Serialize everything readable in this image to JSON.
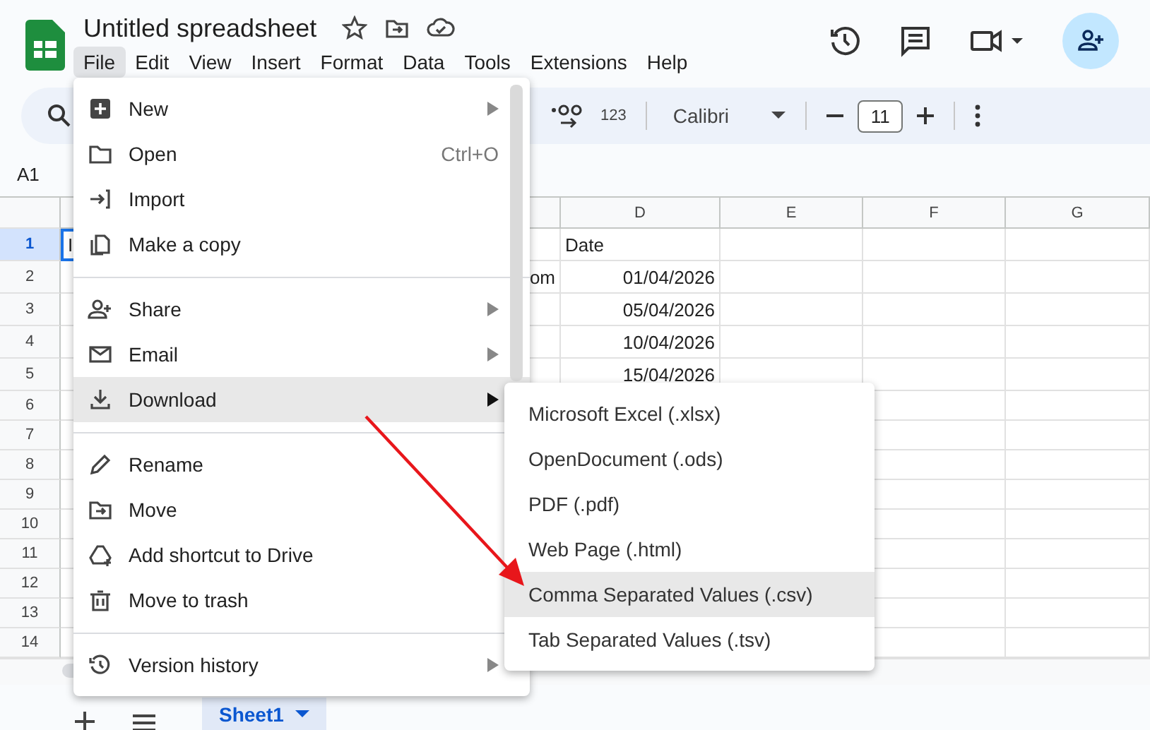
{
  "app": {
    "title": "Untitled spreadsheet"
  },
  "menubar": [
    {
      "label": "File",
      "selected": true
    },
    {
      "label": "Edit",
      "selected": false
    },
    {
      "label": "View",
      "selected": false
    },
    {
      "label": "Insert",
      "selected": false
    },
    {
      "label": "Format",
      "selected": false
    },
    {
      "label": "Data",
      "selected": false
    },
    {
      "label": "Tools",
      "selected": false
    },
    {
      "label": "Extensions",
      "selected": false
    },
    {
      "label": "Help",
      "selected": false
    }
  ],
  "toolbar": {
    "number_format": "123",
    "font": "Calibri",
    "font_size": "11"
  },
  "name_box": "A1",
  "columns": [
    "D",
    "E",
    "F",
    "G"
  ],
  "rows": [
    {
      "number": "1",
      "selected": true,
      "cells": {
        "A": "I",
        "D": "Date"
      }
    },
    {
      "number": "2",
      "selected": false,
      "cells": {
        "C": "om",
        "D": "01/04/2026"
      }
    },
    {
      "number": "3",
      "selected": false,
      "cells": {
        "D": "05/04/2026"
      }
    },
    {
      "number": "4",
      "selected": false,
      "cells": {
        "D": "10/04/2026"
      }
    },
    {
      "number": "5",
      "selected": false,
      "cells": {
        "D": "15/04/2026"
      }
    },
    {
      "number": "6",
      "selected": false,
      "cells": {}
    },
    {
      "number": "7",
      "selected": false,
      "cells": {}
    },
    {
      "number": "8",
      "selected": false,
      "cells": {}
    },
    {
      "number": "9",
      "selected": false,
      "cells": {}
    },
    {
      "number": "10",
      "selected": false,
      "cells": {}
    },
    {
      "number": "11",
      "selected": false,
      "cells": {}
    },
    {
      "number": "12",
      "selected": false,
      "cells": {}
    },
    {
      "number": "13",
      "selected": false,
      "cells": {}
    },
    {
      "number": "14",
      "selected": false,
      "cells": {}
    }
  ],
  "file_menu": {
    "groups": [
      [
        {
          "label": "New",
          "submenu": true,
          "selected": false
        },
        {
          "label": "Open",
          "shortcut": "Ctrl+O",
          "submenu": false,
          "selected": false
        },
        {
          "label": "Import",
          "submenu": false,
          "selected": false
        },
        {
          "label": "Make a copy",
          "submenu": false,
          "selected": false
        }
      ],
      [
        {
          "label": "Share",
          "submenu": true,
          "selected": false
        },
        {
          "label": "Email",
          "submenu": true,
          "selected": false
        },
        {
          "label": "Download",
          "submenu": true,
          "selected": true
        }
      ],
      [
        {
          "label": "Rename",
          "submenu": false,
          "selected": false
        },
        {
          "label": "Move",
          "submenu": false,
          "selected": false
        },
        {
          "label": "Add shortcut to Drive",
          "submenu": false,
          "selected": false
        },
        {
          "label": "Move to trash",
          "submenu": false,
          "selected": false
        }
      ],
      [
        {
          "label": "Version history",
          "submenu": true,
          "selected": false
        }
      ]
    ]
  },
  "download_menu": {
    "items": [
      {
        "label": "Microsoft Excel (.xlsx)",
        "selected": false
      },
      {
        "label": "OpenDocument (.ods)",
        "selected": false
      },
      {
        "label": "PDF (.pdf)",
        "selected": false
      },
      {
        "label": "Web Page (.html)",
        "selected": false
      },
      {
        "label": "Comma Separated Values (.csv)",
        "selected": true
      },
      {
        "label": "Tab Separated Values (.tsv)",
        "selected": false
      }
    ]
  },
  "sheet_tabs": [
    {
      "label": "Sheet1",
      "selected": true
    }
  ]
}
